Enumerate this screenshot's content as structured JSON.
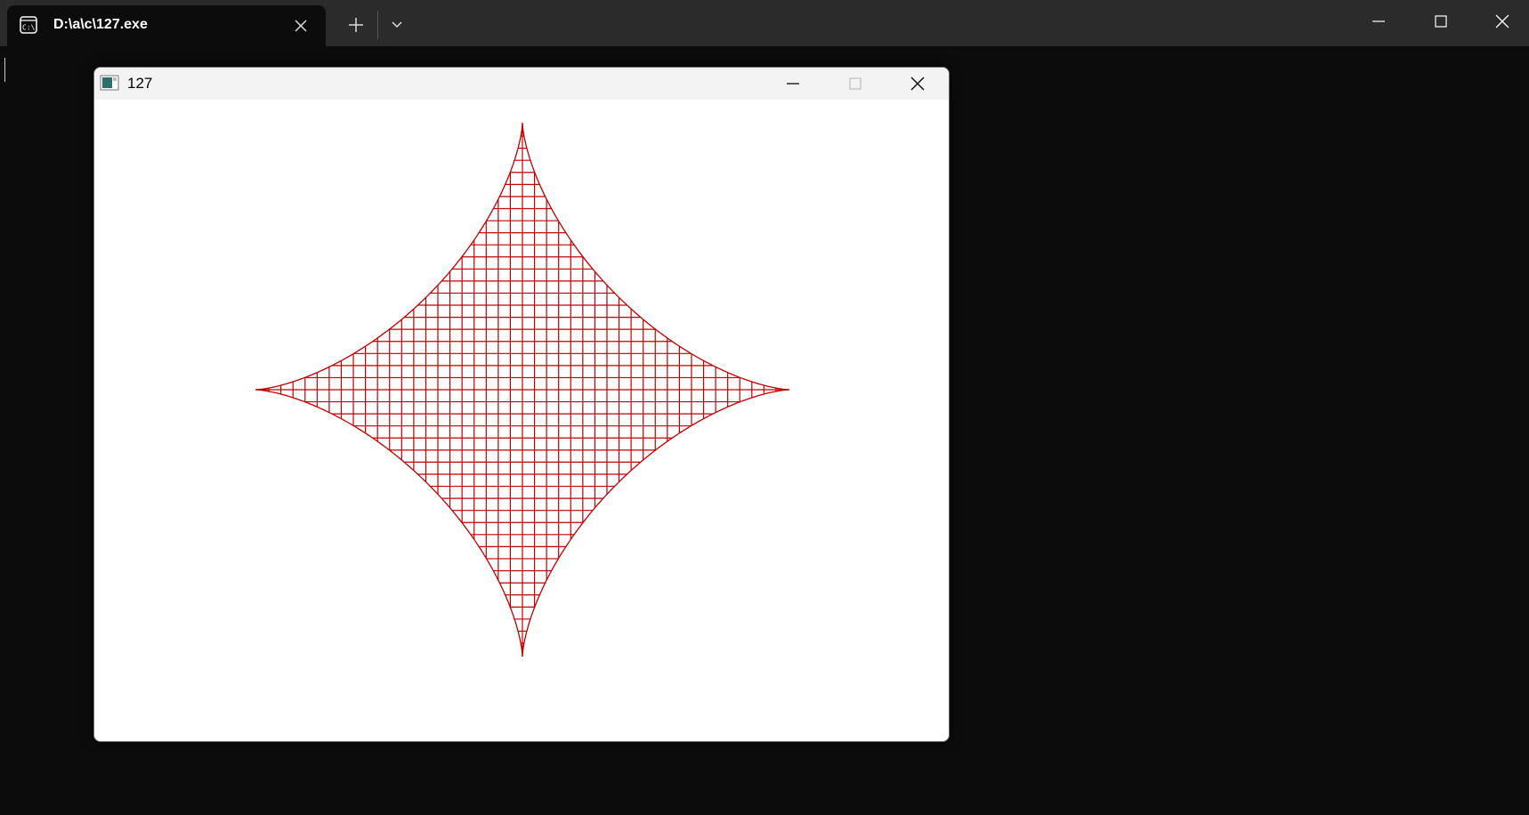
{
  "terminal": {
    "tab_title": "D:\\a\\c\\127.exe",
    "tab_icon": "terminal-icon",
    "new_tab_icon": "plus-icon",
    "dropdown_icon": "chevron-down-icon",
    "caption_icons": [
      "minimize-icon",
      "maximize-icon",
      "close-icon"
    ],
    "background_color": "#0c0c0c",
    "tabbar_color": "#2b2b2b"
  },
  "window": {
    "title": "127",
    "app_icon": "console-app-icon",
    "caption_icons": [
      "minimize-icon",
      "maximize-icon-disabled",
      "close-icon"
    ]
  },
  "drawing": {
    "shape": "astroid mesh",
    "stroke_color": "#c00000",
    "background_color": "#ffffff"
  }
}
